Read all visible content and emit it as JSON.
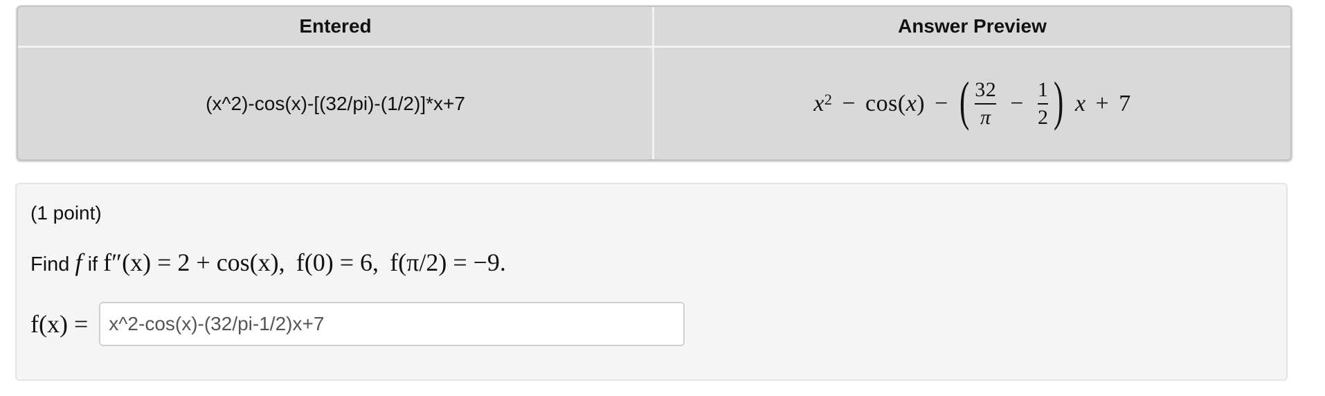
{
  "table": {
    "headers": [
      "Entered",
      "Answer Preview"
    ],
    "entered_value": "(x^2)-cos(x)-[(32/pi)-(1/2)]*x+7",
    "preview": {
      "x": "x",
      "exp": "2",
      "minus1": "−",
      "cos": "cos(",
      "cos_arg": "x",
      "cos_close": ")",
      "minus2": "−",
      "lparen": "(",
      "frac1_num": "32",
      "frac1_den": "π",
      "minus3": "−",
      "frac2_num": "1",
      "frac2_den": "2",
      "rparen": ")",
      "x2": "x",
      "plus": "+",
      "seven": "7"
    }
  },
  "problem": {
    "points": "(1 point)",
    "find": "Find",
    "f": "f",
    "if": "if",
    "condition_1": "f″(x) = 2 + cos(x),",
    "condition_2": "f(0) = 6,",
    "condition_3": "f(π/2) = −9.",
    "answer_label": "f(x) =",
    "answer_value": "x^2-cos(x)-(32/pi-1/2)x+7"
  }
}
